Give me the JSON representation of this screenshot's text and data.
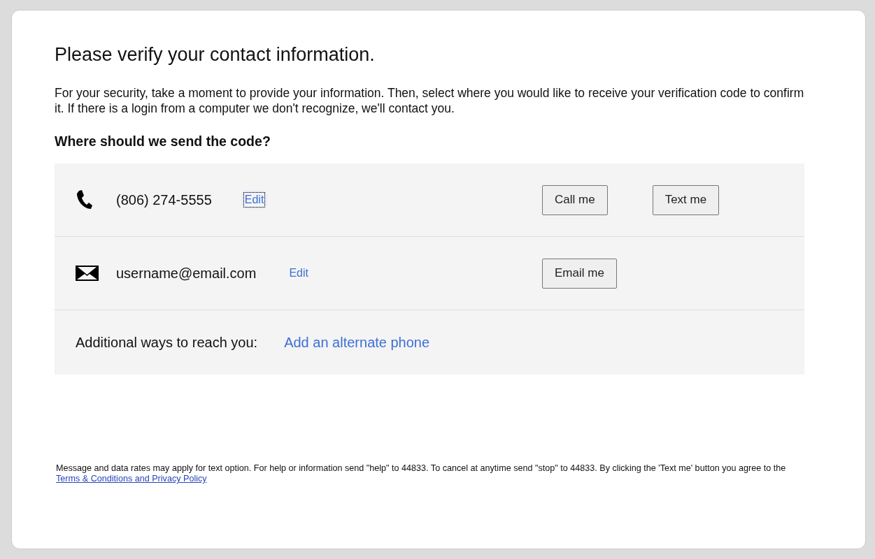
{
  "title": "Please verify your contact information.",
  "intro": "For your security, take a moment to provide your information. Then, select where you would like to receive your verification code to confirm it. If there is a login from a computer we don't recognize, we'll contact you.",
  "question": "Where should we send the code?",
  "contacts": [
    {
      "kind": "phone",
      "value": "(806) 274-5555",
      "edit": {
        "label": "Edit",
        "focused": true
      },
      "buttons": [
        "Call me",
        "Text me"
      ]
    },
    {
      "kind": "email",
      "value": "username@email.com",
      "edit": {
        "label": "Edit",
        "focused": false
      },
      "buttons": [
        "Email me"
      ]
    }
  ],
  "additional": {
    "label": "Additional ways to reach you:",
    "link": "Add an alternate phone"
  },
  "footer": {
    "text": "Message and data rates may apply for text option. For help or information send \"help\" to 44833. To cancel at anytime send \"stop\" to 44833. By clicking the 'Text me' button you agree to the",
    "link": "Terms & Conditions and Privacy Policy"
  }
}
